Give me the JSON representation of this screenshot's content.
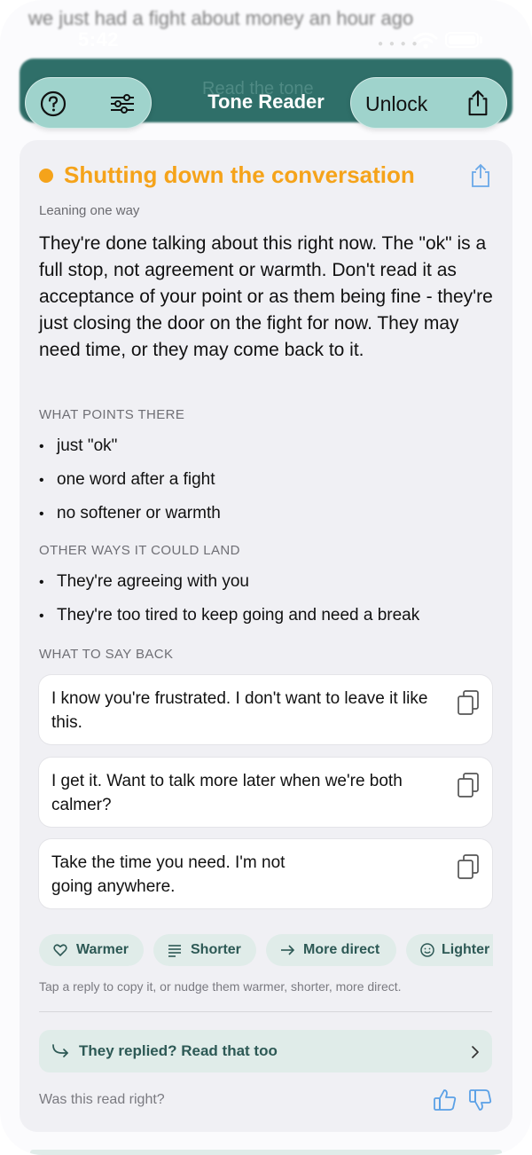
{
  "background_message": "we just had a fight about money an hour ago",
  "status_bar": {
    "time": "5:42"
  },
  "nav": {
    "faded_label": "Read the tone",
    "title": "Tone Reader",
    "unlock_label": "Unlock"
  },
  "result": {
    "headline": "Shutting down the conversation",
    "confidence": "Leaning one way",
    "summary": "They're done talking about this right now. The \"ok\" is a full stop, not agreement or warmth. Don't read it as acceptance of your point or as them being fine - they're just closing the door on the fight for now. They may need time, or they may come back to it.",
    "colors": {
      "accent": "#f5a31a",
      "teal": "#2d5955",
      "chip_bg": "#e0ece9"
    }
  },
  "sections": {
    "points_heading": "WHAT POINTS THERE",
    "points": [
      "just \"ok\"",
      "one word after a fight",
      "no softener or warmth"
    ],
    "other_heading": "OTHER WAYS IT COULD LAND",
    "other": [
      "They're agreeing with you",
      "They're too tired to keep going and need a break"
    ],
    "replies_heading": "WHAT TO SAY BACK",
    "replies": [
      "I know you're frustrated. I don't want to leave it like this.",
      "I get it. Want to talk more later when we're both calmer?",
      "Take the time you need. I'm not going anywhere."
    ]
  },
  "chips": [
    {
      "label": "Warmer",
      "icon": "heart-icon"
    },
    {
      "label": "Shorter",
      "icon": "lines-icon"
    },
    {
      "label": "More direct",
      "icon": "arrow-right-icon"
    },
    {
      "label": "Lighter",
      "icon": "smiley-icon"
    }
  ],
  "hint": "Tap a reply to copy it, or nudge them warmer, shorter, more direct.",
  "replied_link": "They replied? Read that too",
  "feedback_prompt": "Was this read right?"
}
